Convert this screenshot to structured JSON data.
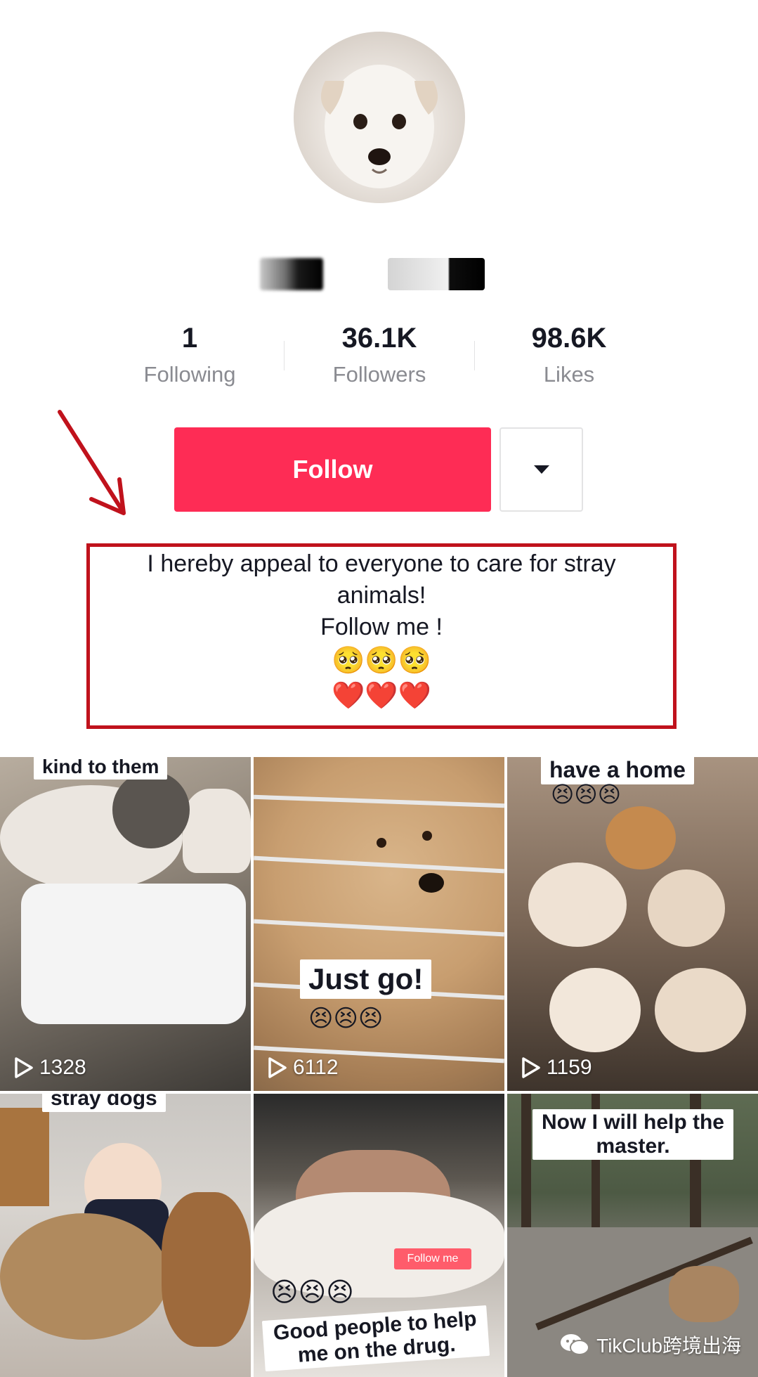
{
  "profile": {
    "stats": [
      {
        "value": "1",
        "label": "Following"
      },
      {
        "value": "36.1K",
        "label": "Followers"
      },
      {
        "value": "98.6K",
        "label": "Likes"
      }
    ],
    "follow_label": "Follow",
    "bio": {
      "line1": "I hereby appeal to everyone to care for stray",
      "line2": "animals!",
      "line3": "Follow me !",
      "emojis1": "🥺🥺🥺",
      "emojis2": "❤️❤️❤️"
    }
  },
  "videos": [
    {
      "caption": "kind to them",
      "views": "1328"
    },
    {
      "caption": "Just go!",
      "sub": "😣😣😣",
      "views": "6112"
    },
    {
      "caption": "have a home",
      "sub": "😣😣😣",
      "views": "1159"
    },
    {
      "caption": "stray dogs"
    },
    {
      "caption": "Good people to help me on the drug.",
      "sub": "😣😣😣",
      "badge": "Follow me"
    },
    {
      "caption": "Now I will help the master."
    }
  ],
  "watermark": "TikClub跨境出海",
  "colors": {
    "accent": "#fe2c55",
    "highlight": "#c0121c"
  }
}
